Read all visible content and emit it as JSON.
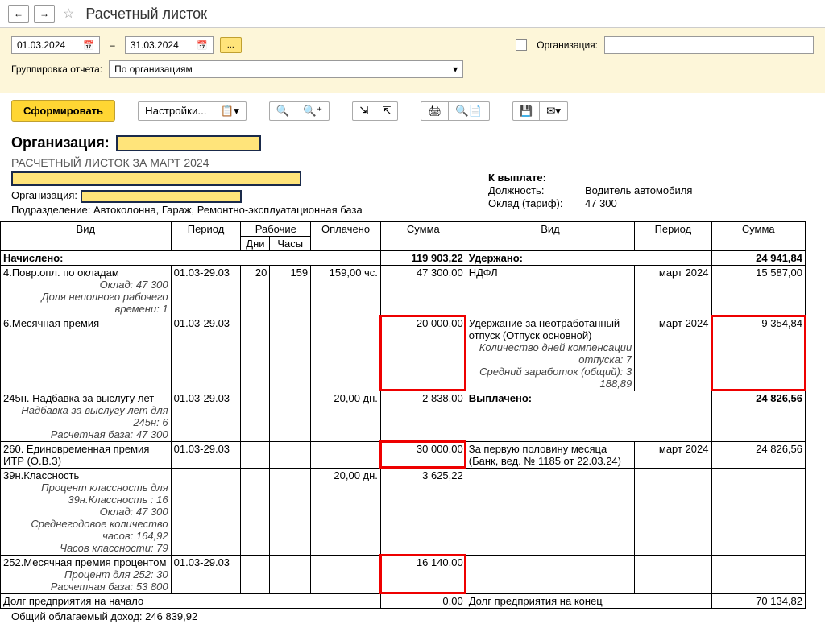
{
  "header": {
    "title": "Расчетный листок"
  },
  "filter": {
    "date_from": "01.03.2024",
    "date_to": "31.03.2024",
    "ellipsis": "...",
    "org_checkbox_label": "Организация:",
    "group_label": "Группировка отчета:",
    "group_value": "По организациям"
  },
  "actions": {
    "form": "Сформировать",
    "settings": "Настройки..."
  },
  "report": {
    "org_label": "Организация:",
    "title": "РАСЧЕТНЫЙ ЛИСТОК ЗА МАРТ 2024",
    "org2_label": "Организация:",
    "subdiv_label": "Подразделение:",
    "subdiv_value": "Автоколонна, Гараж, Ремонтно-эксплуатационная база",
    "kvyplate": "К выплате:",
    "post_label": "Должность:",
    "post_value": "Водитель автомобиля",
    "salary_label": "Оклад (тариф):",
    "salary_value": "47 300"
  },
  "headers": {
    "vid": "Вид",
    "period": "Период",
    "rabochie": "Рабочие",
    "oplacheno": "Оплачено",
    "summa": "Сумма",
    "dni": "Дни",
    "chasy": "Часы"
  },
  "accrued": {
    "label": "Начислено:",
    "total": "119 903,22",
    "rows": [
      {
        "name": "4.Повр.опл. по окладам",
        "sub": "Оклад: 47 300\nДоля неполного рабочего времени: 1",
        "period": "01.03-29.03",
        "dni": "20",
        "chasy": "159",
        "opl": "159,00 чс.",
        "sum": "47 300,00",
        "mark": false
      },
      {
        "name": "6.Месячная премия",
        "sub": "",
        "period": "01.03-29.03",
        "dni": "",
        "chasy": "",
        "opl": "",
        "sum": "20 000,00",
        "mark": true
      },
      {
        "name": "245н. Надбавка за выслугу лет",
        "sub": "Надбавка за выслугу лет для 245н: 6\nРасчетная база: 47 300",
        "period": "01.03-29.03",
        "dni": "",
        "chasy": "",
        "opl": "20,00 дн.",
        "sum": "2 838,00",
        "mark": false
      },
      {
        "name": "260. Единовременная премия  ИТР (О.В.З)",
        "sub": "",
        "period": "01.03-29.03",
        "dni": "",
        "chasy": "",
        "opl": "",
        "sum": "30 000,00",
        "mark": true
      },
      {
        "name": "39н.Классность",
        "sub": "Процент классность для 39н.Классность : 16\nОклад: 47 300\nСреднегодовое количество часов: 164,92\nЧасов классности: 79",
        "period": "",
        "dni": "",
        "chasy": "",
        "opl": "20,00 дн.",
        "sum": "3 625,22",
        "mark": false
      },
      {
        "name": "252.Месячная премия процентом",
        "sub": "Процент для 252: 30\nРасчетная база: 53 800",
        "period": "01.03-29.03",
        "dni": "",
        "chasy": "",
        "opl": "",
        "sum": "16 140,00",
        "mark": true
      }
    ]
  },
  "deducted": {
    "label": "Удержано:",
    "total": "24 941,84",
    "rows": [
      {
        "name": "НДФЛ",
        "sub": "",
        "period": "март 2024",
        "sum": "15 587,00",
        "mark": false
      },
      {
        "name": "Удержание за неотработанный отпуск (Отпуск основной)",
        "sub": "Количество дней компенсации отпуска: 7\nСредний заработок (общий): 3 188,89",
        "period": "март 2024",
        "sum": "9 354,84",
        "mark": true
      }
    ]
  },
  "paid": {
    "label": "Выплачено:",
    "total": "24 826,56",
    "rows": [
      {
        "name": "За первую половину месяца (Банк, вед. № 1185 от 22.03.24)",
        "period": "март 2024",
        "sum": "24 826,56"
      }
    ]
  },
  "footer": {
    "debt_start_label": "Долг предприятия на начало",
    "debt_start_value": "0,00",
    "debt_end_label": "Долг предприятия на конец",
    "debt_end_value": "70 134,82",
    "taxable_label": "Общий облагаемый доход:",
    "taxable_value": "246 839,92"
  }
}
